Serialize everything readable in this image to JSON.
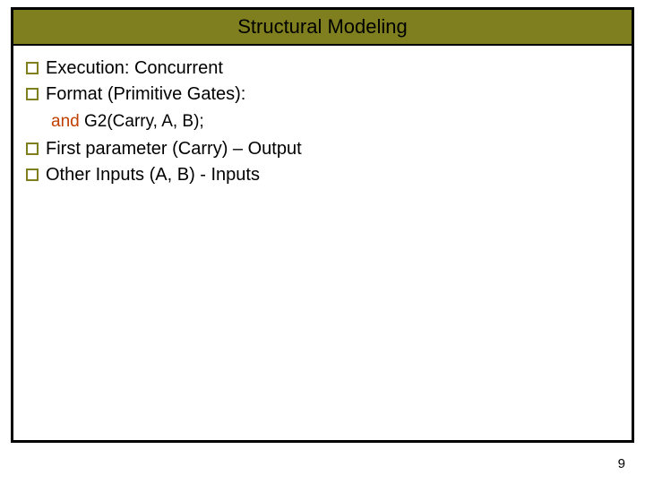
{
  "title": "Structural Modeling",
  "bullets": {
    "b0": "Execution: Concurrent",
    "b1": "Format (Primitive Gates):",
    "b2": "First parameter (Carry) – Output",
    "b3": "Other Inputs (A, B) - Inputs"
  },
  "code": {
    "kw": "and",
    "rest": " G2(Carry, A, B);"
  },
  "page_number": "9",
  "colors": {
    "title_bar": "#7f7f1f",
    "bullet_border": "#7f7f1f",
    "keyword": "#c04000",
    "frame_border": "#000000"
  }
}
